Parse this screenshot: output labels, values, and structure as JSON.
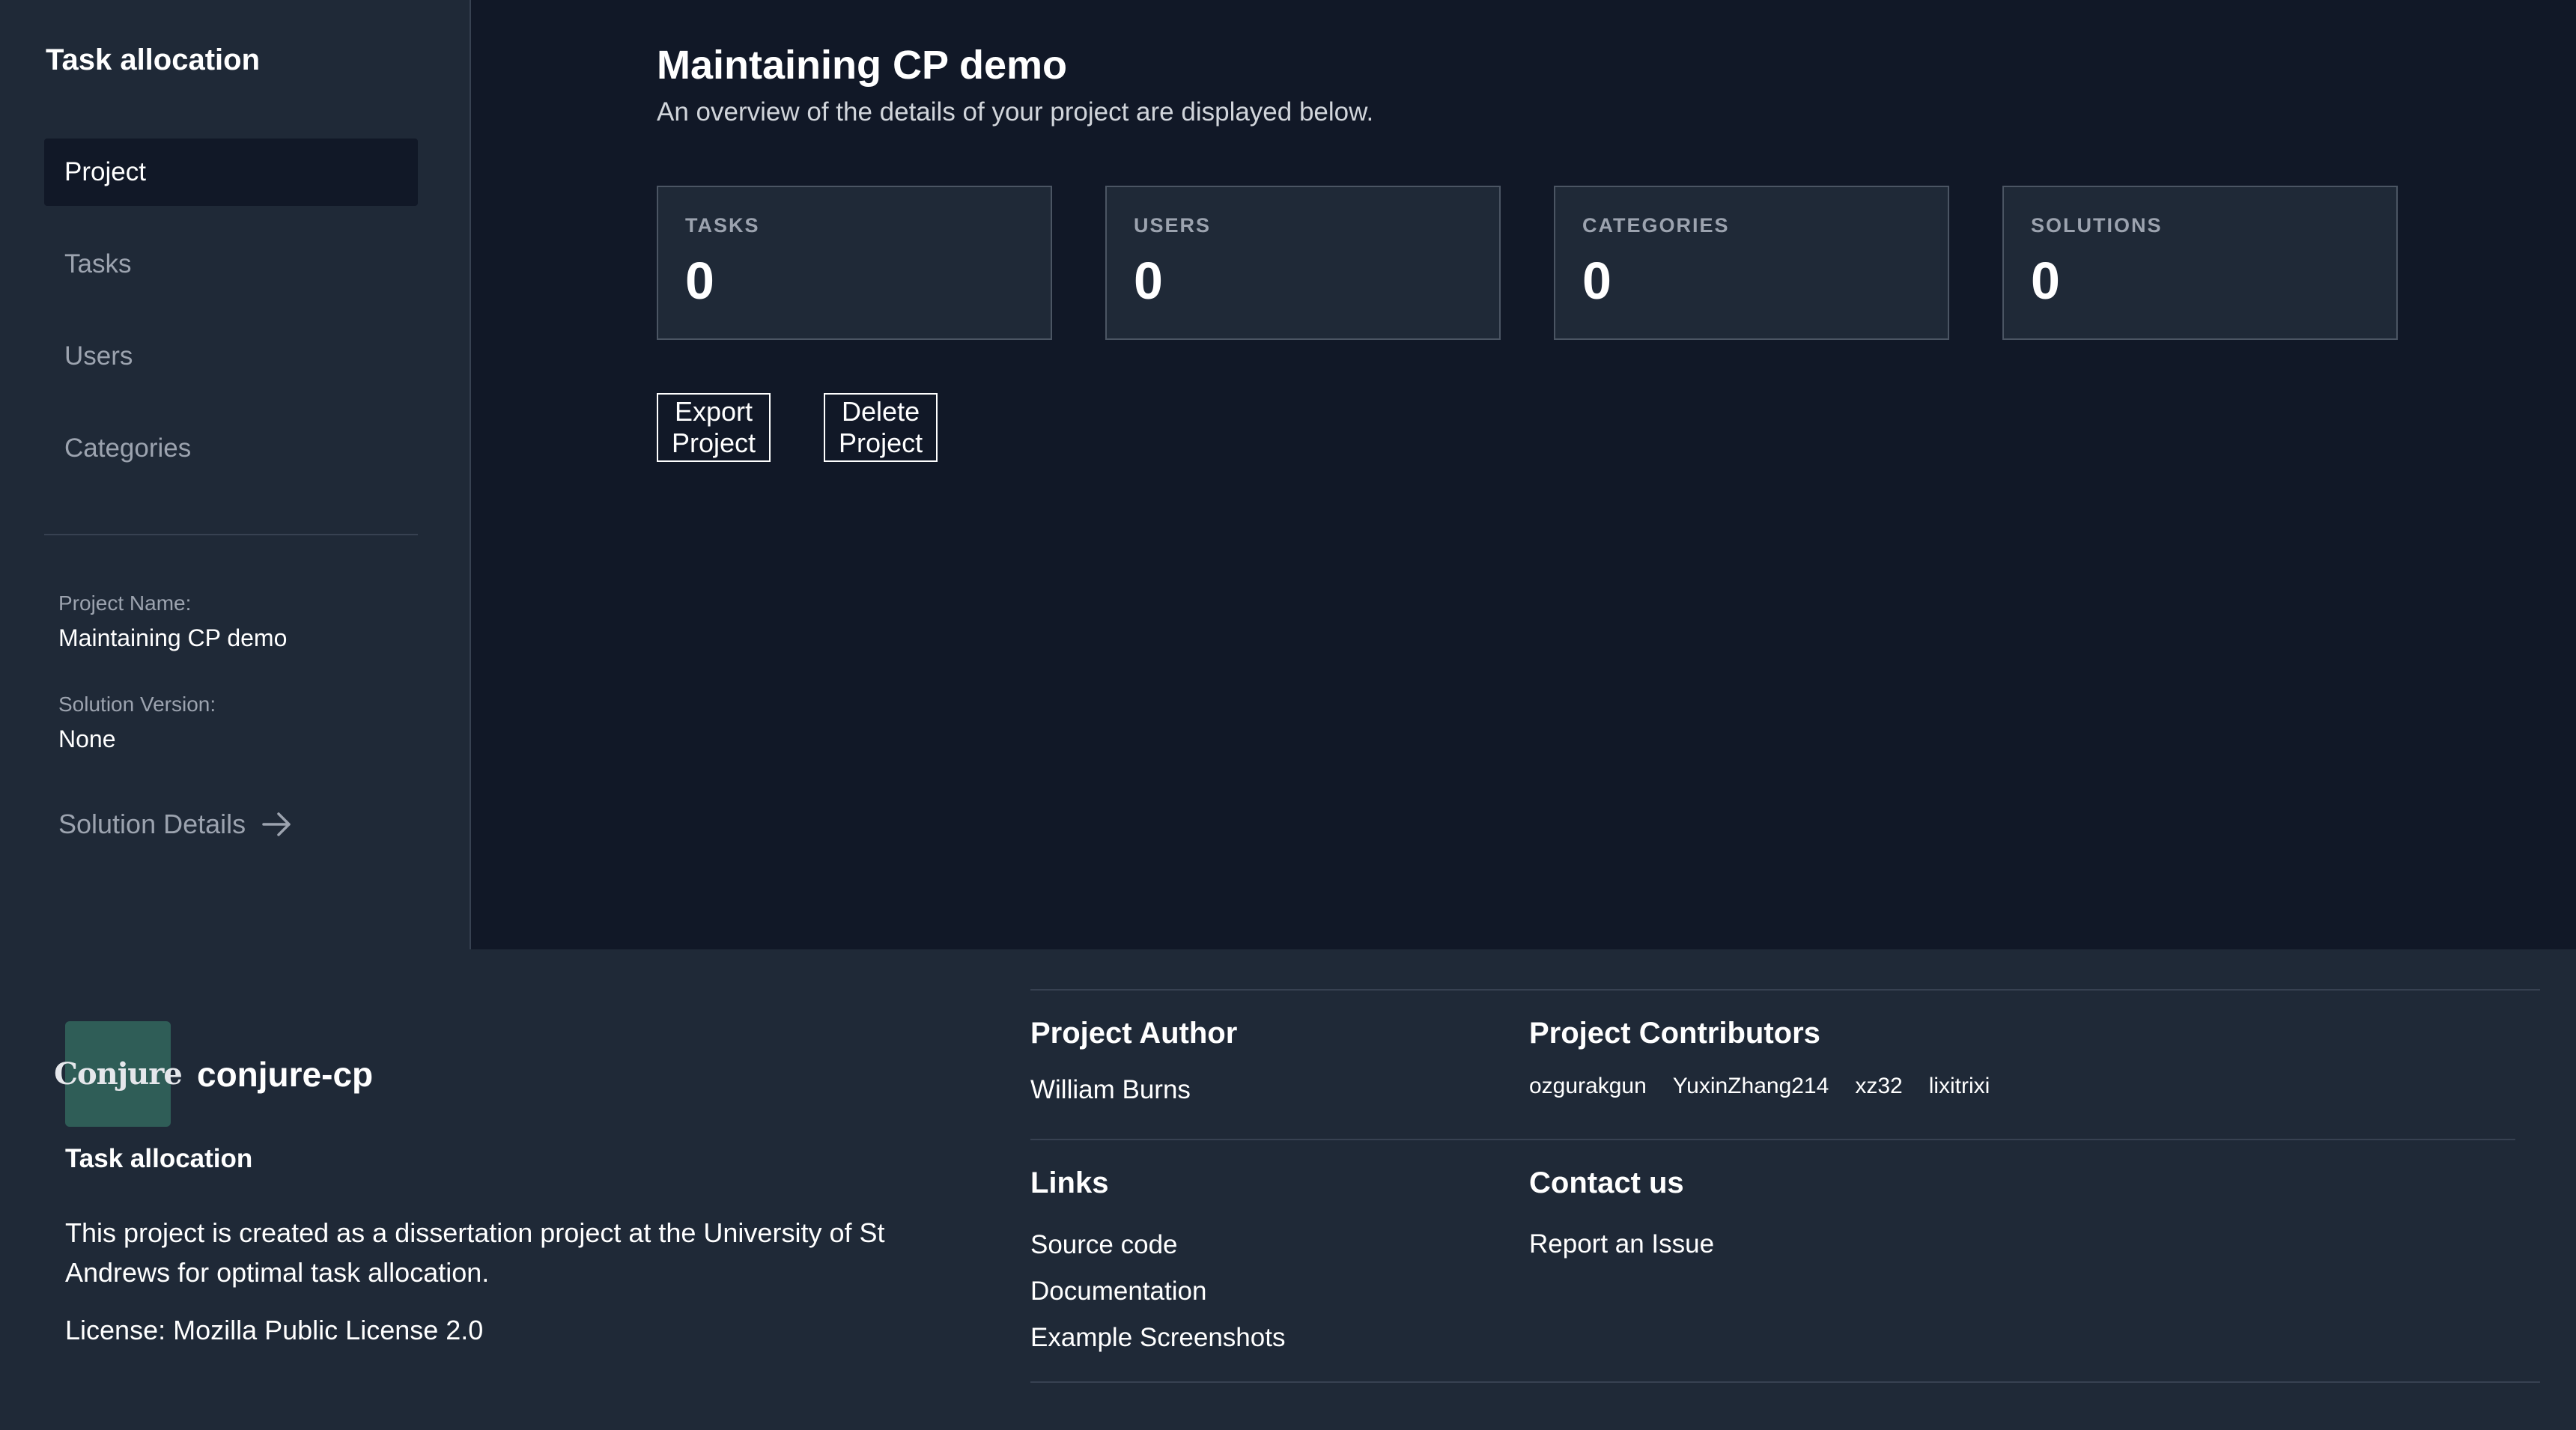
{
  "sidebar": {
    "title": "Task allocation",
    "nav": [
      "Project",
      "Tasks",
      "Users",
      "Categories"
    ],
    "project_name_label": "Project Name:",
    "project_name_value": "Maintaining CP demo",
    "solution_version_label": "Solution Version:",
    "solution_version_value": "None",
    "solution_details": "Solution Details"
  },
  "main": {
    "title": "Maintaining CP demo",
    "subtitle": "An overview of the details of your project are displayed below.",
    "stats": [
      {
        "label": "TASKS",
        "value": "0"
      },
      {
        "label": "USERS",
        "value": "0"
      },
      {
        "label": "CATEGORIES",
        "value": "0"
      },
      {
        "label": "SOLUTIONS",
        "value": "0"
      }
    ],
    "export_label": "Export Project",
    "delete_label": "Delete Project"
  },
  "footer": {
    "logo_text": "Conjure",
    "brand": "conjure-cp",
    "app_name": "Task allocation",
    "description": "This project is created as a dissertation project at the University of St Andrews for optimal task allocation.",
    "license": "License: Mozilla Public License 2.0",
    "author_heading": "Project Author",
    "author": "William Burns",
    "contributors_heading": "Project Contributors",
    "contributors": [
      "ozgurakgun",
      "YuxinZhang214",
      "xz32",
      "lixitrixi"
    ],
    "links_heading": "Links",
    "links": [
      "Source code",
      "Documentation",
      "Example Screenshots"
    ],
    "contact_heading": "Contact us",
    "contact": "Report an Issue"
  },
  "colors": {
    "background": "#111827",
    "panel": "#1f2937",
    "logo_bg": "#2f5d57"
  }
}
